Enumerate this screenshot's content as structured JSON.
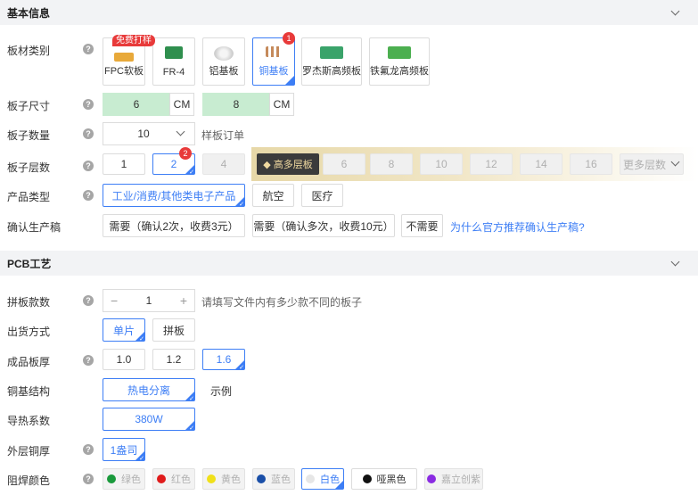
{
  "basic_section": {
    "title": "基本信息"
  },
  "pcb_section": {
    "title": "PCB工艺"
  },
  "board_type": {
    "label": "板材类别",
    "free_tag": "免费打样",
    "badge": "1",
    "options": [
      {
        "label": "FPC软板",
        "color": "#e8a93a"
      },
      {
        "label": "FR-4",
        "color": "#2f8f4e"
      },
      {
        "label": "铝基板",
        "color": "#cfcfcf"
      },
      {
        "label": "铜基板",
        "color": "#c58a5b"
      },
      {
        "label": "罗杰斯高频板",
        "color": "#3aa36a"
      },
      {
        "label": "铁氟龙高频板",
        "color": "#4caf50"
      }
    ]
  },
  "board_size": {
    "label": "板子尺寸",
    "width": "6",
    "height": "8",
    "unit": "CM"
  },
  "board_qty": {
    "label": "板子数量",
    "value": "10",
    "hint": "样板订单"
  },
  "layers": {
    "label": "板子层数",
    "badge": "2",
    "options": [
      "1",
      "2",
      "4"
    ],
    "high_label": "高多层板",
    "high_options": [
      "6",
      "8",
      "10",
      "12",
      "14",
      "16"
    ],
    "more": "更多层数"
  },
  "product_type": {
    "label": "产品类型",
    "options": [
      "工业/消费/其他类电子产品",
      "航空",
      "医疗"
    ]
  },
  "confirm": {
    "label": "确认生产稿",
    "options": [
      "需要（确认2次，收费3元）",
      "需要（确认多次，收费10元）",
      "不需要"
    ],
    "link": "为什么官方推荐确认生产稿?"
  },
  "panel_count": {
    "label": "拼板款数",
    "value": "1",
    "hint": "请填写文件内有多少款不同的板子"
  },
  "shipping": {
    "label": "出货方式",
    "options": [
      "单片",
      "拼板"
    ]
  },
  "thickness": {
    "label": "成品板厚",
    "options": [
      "1.0",
      "1.2",
      "1.6"
    ]
  },
  "copper_struct": {
    "label": "铜基结构",
    "value": "热电分离",
    "hint": "示例"
  },
  "thermal": {
    "label": "导热系数",
    "value": "380W"
  },
  "outer_copper": {
    "label": "外层铜厚",
    "value": "1盎司"
  },
  "solder_mask": {
    "label": "阻焊颜色",
    "options": [
      {
        "label": "绿色",
        "color": "#1a9a3c"
      },
      {
        "label": "红色",
        "color": "#e01b1b"
      },
      {
        "label": "黄色",
        "color": "#f0e01a"
      },
      {
        "label": "蓝色",
        "color": "#1a4fa8"
      },
      {
        "label": "白色",
        "color": "#e6e6e6"
      },
      {
        "label": "哑黑色",
        "color": "#111111"
      },
      {
        "label": "嘉立创紫",
        "color": "#8a2be2"
      }
    ]
  },
  "help_glyph": "?"
}
